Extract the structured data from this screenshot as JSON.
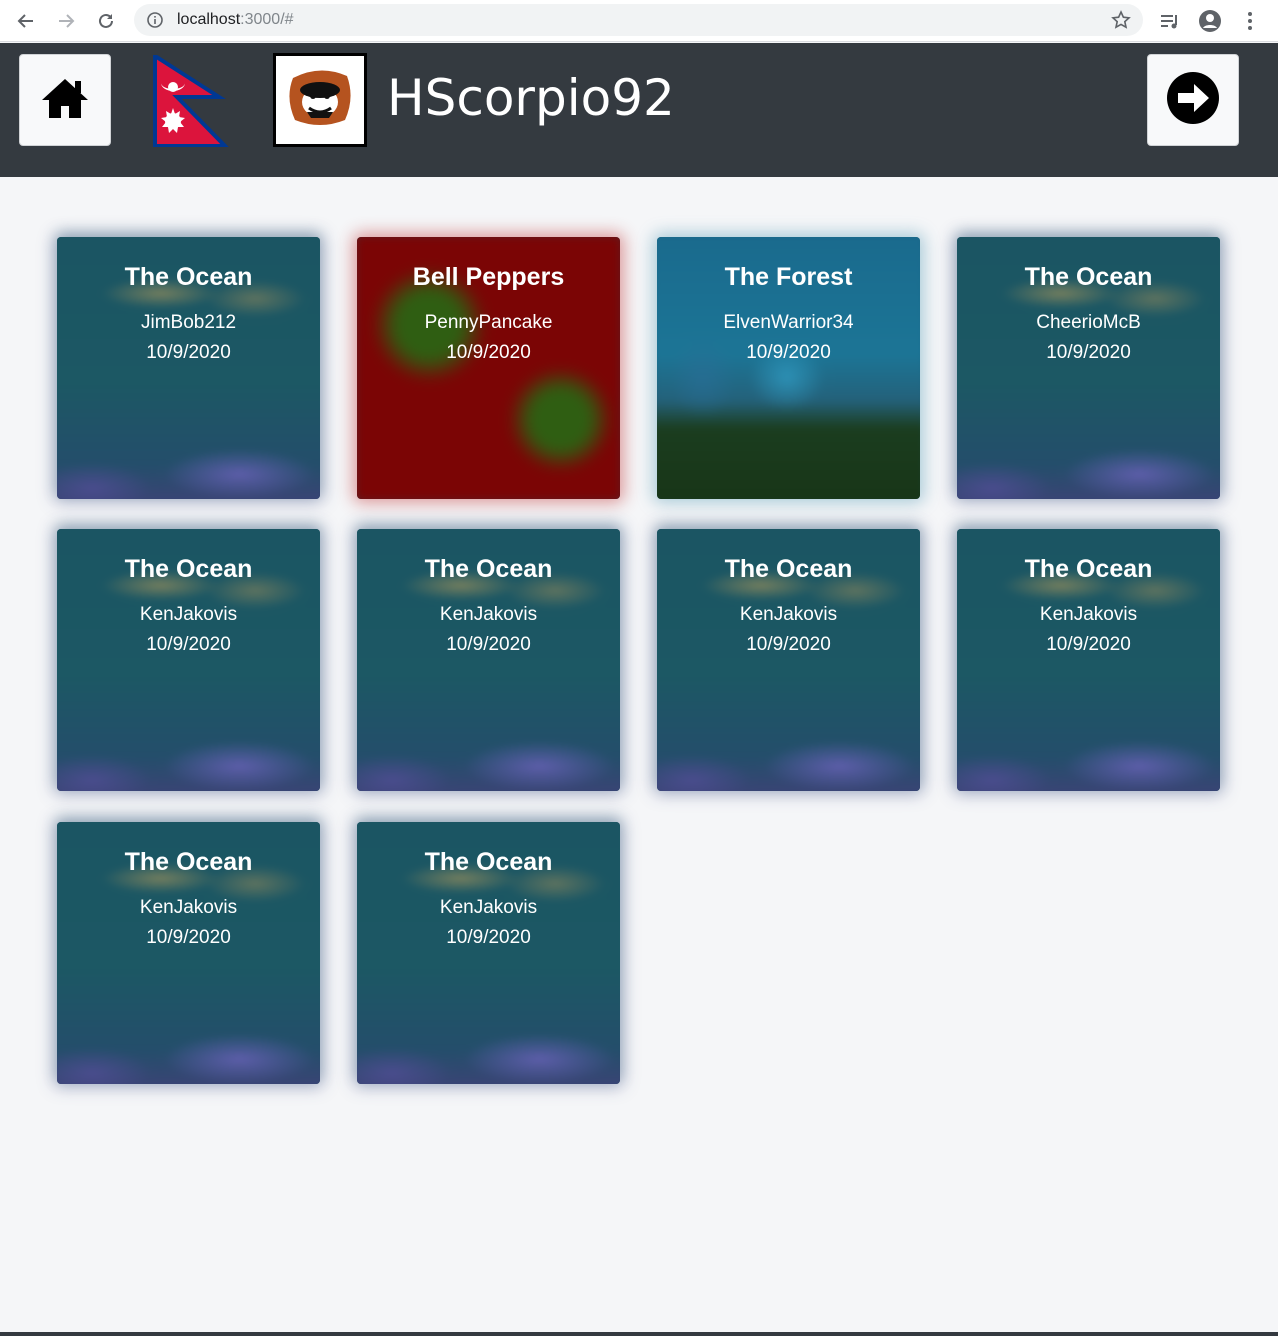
{
  "browser": {
    "url_host": "localhost",
    "url_rest": ":3000/#"
  },
  "header": {
    "username": "HScorpio92",
    "home_icon": "home-icon",
    "next_icon": "arrow-right-circle-icon",
    "flag_icon": "nepal-flag-icon",
    "avatar_icon": "monkey-avatar-icon",
    "background_color": "#343a40"
  },
  "gallery": {
    "cards": [
      {
        "title": "The Ocean",
        "author": "JimBob212",
        "date": "10/9/2020",
        "theme": "ocean"
      },
      {
        "title": "Bell Peppers",
        "author": "PennyPancake",
        "date": "10/9/2020",
        "theme": "peppers"
      },
      {
        "title": "The Forest",
        "author": "ElvenWarrior34",
        "date": "10/9/2020",
        "theme": "forest"
      },
      {
        "title": "The Ocean",
        "author": "CheerioMcB",
        "date": "10/9/2020",
        "theme": "ocean"
      },
      {
        "title": "The Ocean",
        "author": "KenJakovis",
        "date": "10/9/2020",
        "theme": "ocean"
      },
      {
        "title": "The Ocean",
        "author": "KenJakovis",
        "date": "10/9/2020",
        "theme": "ocean"
      },
      {
        "title": "The Ocean",
        "author": "KenJakovis",
        "date": "10/9/2020",
        "theme": "ocean"
      },
      {
        "title": "The Ocean",
        "author": "KenJakovis",
        "date": "10/9/2020",
        "theme": "ocean"
      },
      {
        "title": "The Ocean",
        "author": "KenJakovis",
        "date": "10/9/2020",
        "theme": "ocean"
      },
      {
        "title": "The Ocean",
        "author": "KenJakovis",
        "date": "10/9/2020",
        "theme": "ocean"
      }
    ]
  }
}
